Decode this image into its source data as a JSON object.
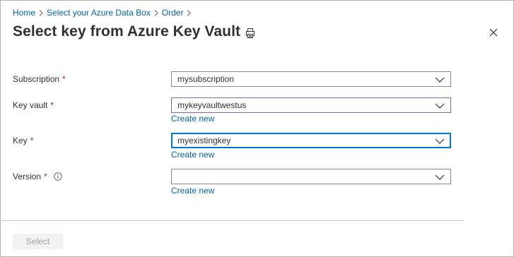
{
  "breadcrumb": {
    "items": [
      "Home",
      "Select your Azure Data Box",
      "Order"
    ]
  },
  "panel": {
    "title": "Select key from Azure Key Vault"
  },
  "icons": {
    "print": "print-icon",
    "close": "close-icon",
    "info": "info-icon",
    "chevron": "chevron-down-icon"
  },
  "form": {
    "required_marker": "*",
    "subscription": {
      "label": "Subscription",
      "value": "mysubscription"
    },
    "key_vault": {
      "label": "Key vault",
      "value": "mykeyvaultwestus",
      "create_link": "Create new"
    },
    "key": {
      "label": "Key",
      "value": "myexistingkey",
      "create_link": "Create new"
    },
    "version": {
      "label": "Version",
      "value": "",
      "create_link": "Create new"
    }
  },
  "footer": {
    "select_label": "Select"
  },
  "colors": {
    "link": "#0063b1",
    "required": "#a4262c",
    "focus_purple": "#8764b8",
    "focus_blue": "#0078d4",
    "disabled_bg": "#f3f2f1",
    "disabled_text": "#a19f9d"
  }
}
